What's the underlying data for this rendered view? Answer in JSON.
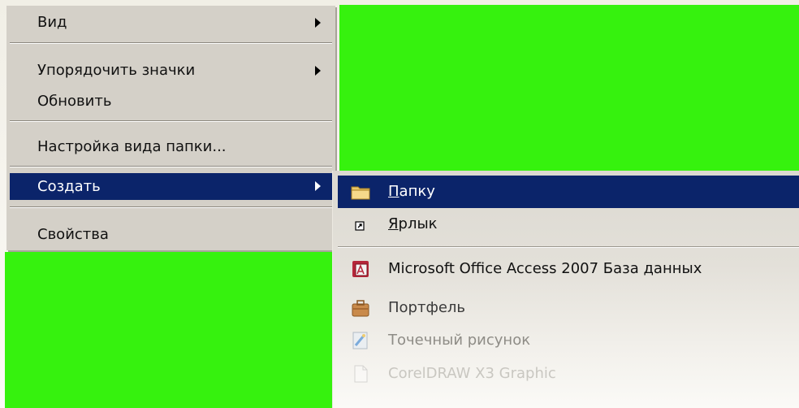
{
  "context_menu": {
    "items": [
      {
        "label": "Вид",
        "has_submenu": true
      },
      {
        "label": "Упорядочить значки",
        "has_submenu": true
      },
      {
        "label": "Обновить",
        "has_submenu": false
      },
      {
        "label": "Настройка вида папки...",
        "has_submenu": false
      },
      {
        "label": "Создать",
        "has_submenu": true,
        "selected": true
      },
      {
        "label": "Свойства",
        "has_submenu": false
      }
    ]
  },
  "submenu": {
    "items": [
      {
        "label_accel": "П",
        "label_rest": "апку",
        "icon": "folder-icon",
        "selected": true
      },
      {
        "label_accel": "Я",
        "label_rest": "рлык",
        "icon": "shortcut-icon"
      },
      {
        "label": "Microsoft Office Access 2007 База данных",
        "icon": "access-database-icon"
      },
      {
        "label": "Портфель",
        "icon": "briefcase-icon"
      },
      {
        "label": "Точечный рисунок",
        "icon": "bitmap-image-icon"
      },
      {
        "label": "CorelDRAW X3 Graphic",
        "icon": "coreldraw-file-icon"
      }
    ]
  },
  "colors": {
    "desktop_green": "#36f20e",
    "menu_face": "#d4d0c8",
    "selection": "#0b246a"
  }
}
